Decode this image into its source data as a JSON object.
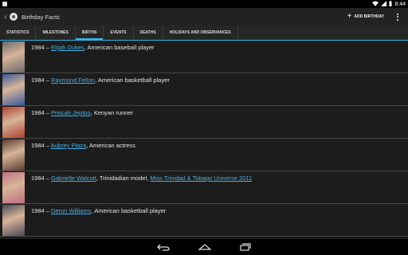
{
  "status_bar": {
    "time": "8:44"
  },
  "app": {
    "title": "Birthday Facts",
    "add_label": "ADD BIRTHDAY"
  },
  "tabs": [
    {
      "label": "STATISTICS"
    },
    {
      "label": "MILESTONES"
    },
    {
      "label": "BIRTHS"
    },
    {
      "label": "EVENTS"
    },
    {
      "label": "DEATHS"
    },
    {
      "label": "HOLIDAYS AND OBSERVANCES"
    }
  ],
  "active_tab": "BIRTHS",
  "accent_color": "#33b5e5",
  "link_color": "#4ab0e6",
  "entries": [
    {
      "year": "1984",
      "sep": " – ",
      "name": "Elijah Dukes",
      "desc": ", American baseball player",
      "link2": "",
      "thumb": "#6a6a6a"
    },
    {
      "year": "1984",
      "sep": " – ",
      "name": "Raymond Felton",
      "desc": ", American basketball player",
      "link2": "",
      "thumb": "#3a5a9a"
    },
    {
      "year": "1984",
      "sep": " – ",
      "name": "Priscah Jeptoo",
      "desc": ", Kenyan runner",
      "link2": "",
      "thumb": "#b04030"
    },
    {
      "year": "1984",
      "sep": " – ",
      "name": "Aubrey Plaza",
      "desc": ", American actress",
      "link2": "",
      "thumb": "#5a3a2e"
    },
    {
      "year": "1984",
      "sep": " – ",
      "name": "Gabrielle Walcott",
      "desc": ", Trinidadian model, ",
      "link2": "Miss Trinidad & Tobago Universe 2011",
      "thumb": "#c07080"
    },
    {
      "year": "1984",
      "sep": " – ",
      "name": "Deron Williams",
      "desc": ", American basketball player",
      "link2": "",
      "thumb": "#4a4a55"
    }
  ]
}
